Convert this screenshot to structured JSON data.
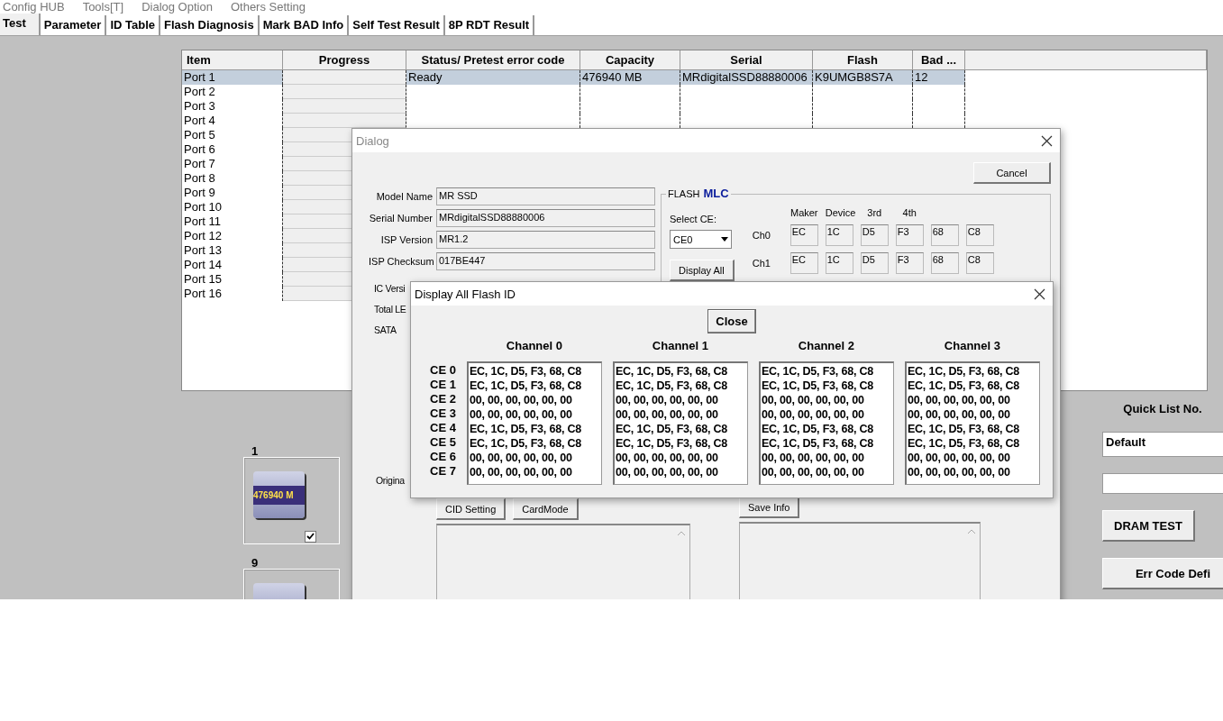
{
  "menu": [
    "Config HUB",
    "Tools[T]",
    "Dialog Option",
    "Others Setting"
  ],
  "tabs": [
    {
      "label": "Test",
      "selected": true
    },
    {
      "label": "Parameter",
      "selected": false
    },
    {
      "label": "ID Table",
      "selected": false
    },
    {
      "label": "Flash Diagnosis",
      "selected": false
    },
    {
      "label": "Mark BAD Info",
      "selected": false
    },
    {
      "label": "Self Test Result",
      "selected": false
    },
    {
      "label": "8P RDT Result",
      "selected": false
    }
  ],
  "port_table": {
    "columns": [
      "Item",
      "Progress",
      "Status/ Pretest error code",
      "Capacity",
      "Serial",
      "Flash",
      "Bad ..."
    ],
    "rows": [
      {
        "item": "Port 1",
        "selected": true,
        "cells": [
          "Ready",
          "476940 MB",
          "MRdigitalSSD88880006",
          "K9UMGB8S7A",
          "12"
        ]
      },
      {
        "item": "Port 2",
        "selected": false
      },
      {
        "item": "Port 3",
        "selected": false
      },
      {
        "item": "Port 4",
        "selected": false
      },
      {
        "item": "Port 5",
        "selected": false
      },
      {
        "item": "Port 6",
        "selected": false
      },
      {
        "item": "Port 7",
        "selected": false
      },
      {
        "item": "Port 8",
        "selected": false
      },
      {
        "item": "Port 9",
        "selected": false
      },
      {
        "item": "Port 10",
        "selected": false
      },
      {
        "item": "Port 11",
        "selected": false
      },
      {
        "item": "Port 12",
        "selected": false
      },
      {
        "item": "Port 13",
        "selected": false
      },
      {
        "item": "Port 14",
        "selected": false
      },
      {
        "item": "Port 15",
        "selected": false
      },
      {
        "item": "Port 16",
        "selected": false
      }
    ]
  },
  "port_tiles": [
    {
      "number": "1",
      "capacity": "476940 M",
      "checked": true
    },
    {
      "number": "9"
    }
  ],
  "quick_list": {
    "title": "Quick List No.",
    "value": "Default",
    "buttons": [
      "DRAM TEST",
      "Err Code Defi"
    ]
  },
  "dialog": {
    "title": "Dialog",
    "cancel": "Cancel",
    "fields": [
      {
        "label": "Model Name",
        "value": "MR SSD"
      },
      {
        "label": "Serial Number",
        "value": "MRdigitalSSD88880006"
      },
      {
        "label": "ISP Version",
        "value": "MR1.2"
      },
      {
        "label": "ISP Checksum",
        "value": "017BE447"
      }
    ],
    "hidden_labels": [
      "IC Versi",
      "Total LE",
      "SATA"
    ],
    "original_label": "Origina",
    "flash": {
      "label": "FLASH",
      "type": "MLC",
      "select_label": "Select CE:",
      "select_value": "CE0",
      "display_all": "Display All",
      "columns": [
        "Maker",
        "Device",
        "3rd",
        "4th"
      ],
      "channels": [
        {
          "name": "Ch0",
          "ids": [
            "EC",
            "1C",
            "D5",
            "F3",
            "68",
            "C8"
          ]
        },
        {
          "name": "Ch1",
          "ids": [
            "EC",
            "1C",
            "D5",
            "F3",
            "68",
            "C8"
          ]
        }
      ]
    },
    "buttons": [
      "CID Setting",
      "CardMode"
    ],
    "save_button": "Save Info"
  },
  "flash_id_dialog": {
    "title": "Display All Flash ID",
    "close": "Close",
    "ce_labels": [
      "CE 0",
      "CE 1",
      "CE 2",
      "CE 3",
      "CE 4",
      "CE 5",
      "CE 6",
      "CE 7"
    ],
    "channels": [
      {
        "name": "Channel 0",
        "ids": [
          "EC, 1C, D5, F3, 68, C8",
          "EC, 1C, D5, F3, 68, C8",
          "00, 00, 00, 00, 00, 00",
          "00, 00, 00, 00, 00, 00",
          "EC, 1C, D5, F3, 68, C8",
          "EC, 1C, D5, F3, 68, C8",
          "00, 00, 00, 00, 00, 00",
          "00, 00, 00, 00, 00, 00"
        ]
      },
      {
        "name": "Channel 1",
        "ids": [
          "EC, 1C, D5, F3, 68, C8",
          "EC, 1C, D5, F3, 68, C8",
          "00, 00, 00, 00, 00, 00",
          "00, 00, 00, 00, 00, 00",
          "EC, 1C, D5, F3, 68, C8",
          "EC, 1C, D5, F3, 68, C8",
          "00, 00, 00, 00, 00, 00",
          "00, 00, 00, 00, 00, 00"
        ]
      },
      {
        "name": "Channel 2",
        "ids": [
          "EC, 1C, D5, F3, 68, C8",
          "EC, 1C, D5, F3, 68, C8",
          "00, 00, 00, 00, 00, 00",
          "00, 00, 00, 00, 00, 00",
          "EC, 1C, D5, F3, 68, C8",
          "EC, 1C, D5, F3, 68, C8",
          "00, 00, 00, 00, 00, 00",
          "00, 00, 00, 00, 00, 00"
        ]
      },
      {
        "name": "Channel 3",
        "ids": [
          "EC, 1C, D5, F3, 68, C8",
          "EC, 1C, D5, F3, 68, C8",
          "00, 00, 00, 00, 00, 00",
          "00, 00, 00, 00, 00, 00",
          "EC, 1C, D5, F3, 68, C8",
          "EC, 1C, D5, F3, 68, C8",
          "00, 00, 00, 00, 00, 00",
          "00, 00, 00, 00, 00, 00"
        ]
      }
    ]
  }
}
